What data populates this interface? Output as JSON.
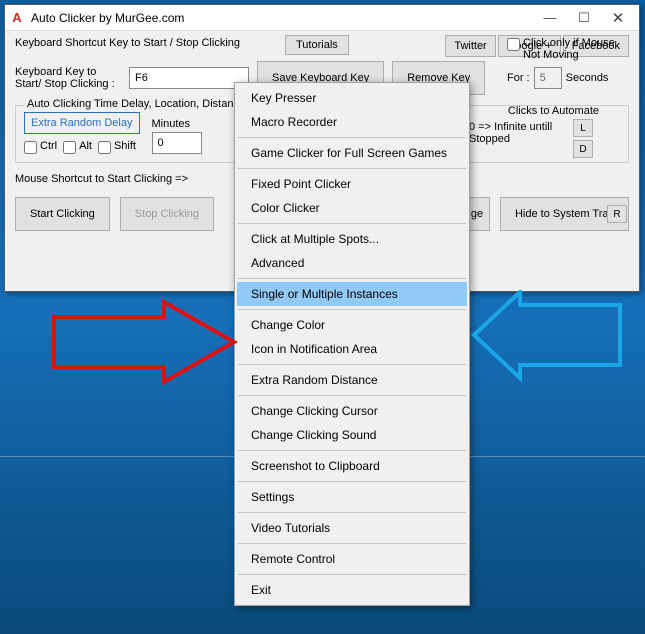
{
  "title": "Auto Clicker by MurGee.com",
  "top": {
    "shortcut_label": "Keyboard Shortcut Key to Start / Stop Clicking",
    "tutorials": "Tutorials",
    "twitter": "Twitter",
    "google": "Google +",
    "facebook": "Facebook",
    "kb_key_label": "Keyboard Key to Start/ Stop Clicking :",
    "kb_value": "F6",
    "save": "Save Keyboard Key",
    "remove": "Remove Key",
    "click_only": "Click only if Mouse Not Moving",
    "for": "For :",
    "for_value": "5",
    "seconds": "Seconds"
  },
  "group": {
    "label": "Auto Clicking Time Delay, Location, Distance, Number of Clicks etc",
    "extra": "Extra Random Delay",
    "ctrl": "Ctrl",
    "alt": "Alt",
    "shift": "Shift",
    "minutes": "Minutes",
    "minutes_value": "0",
    "clicks_label": "Clicks to Automate",
    "infinite": "0 => Infinite untill Stopped",
    "L": "L",
    "D": "D",
    "R": "R"
  },
  "mouse_shortcut": "Mouse Shortcut to Start Clicking =>",
  "bottom": {
    "start": "Start Clicking",
    "stop": "Stop Clicking",
    "hide": "Hide to System Tray",
    "pick": "ge"
  },
  "menu": {
    "items": [
      "Key Presser",
      "Macro Recorder",
      "",
      "Game Clicker for Full Screen Games",
      "",
      "Fixed Point Clicker",
      "Color Clicker",
      "",
      "Click at Multiple Spots...",
      "Advanced",
      "",
      "Single or Multiple Instances",
      "",
      "Change Color",
      "Icon in Notification Area",
      "",
      "Extra Random Distance",
      "",
      "Change Clicking Cursor",
      "Change Clicking Sound",
      "",
      "Screenshot to Clipboard",
      "",
      "Settings",
      "",
      "Video Tutorials",
      "",
      "Remote Control",
      "",
      "Exit"
    ],
    "highlight": "Single or Multiple Instances"
  }
}
